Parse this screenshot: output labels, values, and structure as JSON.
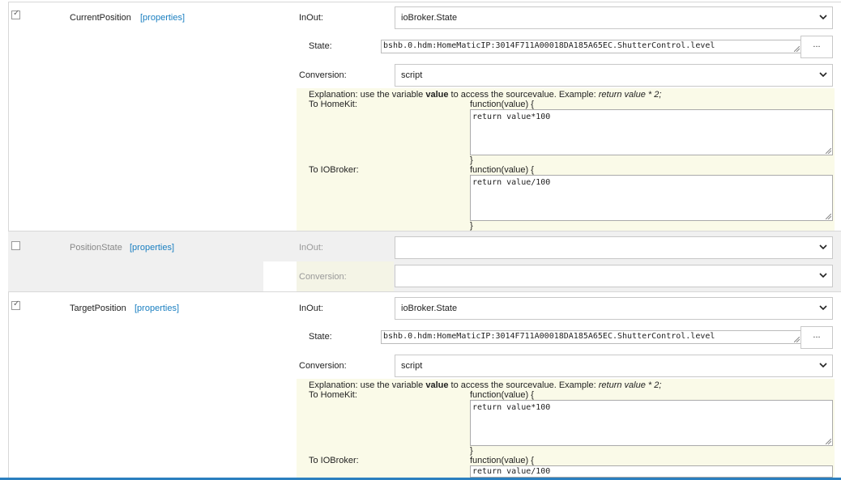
{
  "rows": [
    {
      "checked": true,
      "name": "CurrentPosition",
      "properties_link": "[properties]",
      "inout_label": "InOut:",
      "inout_value": "ioBroker.State",
      "state_label": "State:",
      "state_value": "bshb.0.hdm:HomeMaticIP:3014F711A00018DA185A65EC.ShutterControl.level",
      "browse_label": "...",
      "conversion_label": "Conversion:",
      "conversion_value": "script",
      "explanation_pre": "Explanation: use the variable ",
      "explanation_bold": "value",
      "explanation_mid": " to access the sourcevalue. Example: ",
      "explanation_example": "return value * 2;",
      "to_homekit_label": "To HomeKit:",
      "to_iobroker_label": "To IOBroker:",
      "function_open": "function(value) {",
      "function_close": "}",
      "homekit_code": "return value*100",
      "iobroker_code": "return value/100"
    },
    {
      "checked": false,
      "name": "PositionState",
      "properties_link": "[properties]",
      "inout_label": "InOut:",
      "inout_value": "",
      "conversion_label": "Conversion:",
      "conversion_value": ""
    },
    {
      "checked": true,
      "name": "TargetPosition",
      "properties_link": "[properties]",
      "inout_label": "InOut:",
      "inout_value": "ioBroker.State",
      "state_label": "State:",
      "state_value": "bshb.0.hdm:HomeMaticIP:3014F711A00018DA185A65EC.ShutterControl.level",
      "browse_label": "...",
      "conversion_label": "Conversion:",
      "conversion_value": "script",
      "explanation_pre": "Explanation: use the variable ",
      "explanation_bold": "value",
      "explanation_mid": " to access the sourcevalue. Example: ",
      "explanation_example": "return value * 2;",
      "to_homekit_label": "To HomeKit:",
      "to_iobroker_label": "To IOBroker:",
      "function_open": "function(value) {",
      "function_close": "}",
      "homekit_code": "return value*100",
      "iobroker_code": "return value/100"
    }
  ],
  "colors": {
    "link": "#1a7fc1",
    "script_panel": "#fafae8",
    "disabled_row": "#f0f0f0",
    "bottom_bar": "#2b7fbf"
  }
}
